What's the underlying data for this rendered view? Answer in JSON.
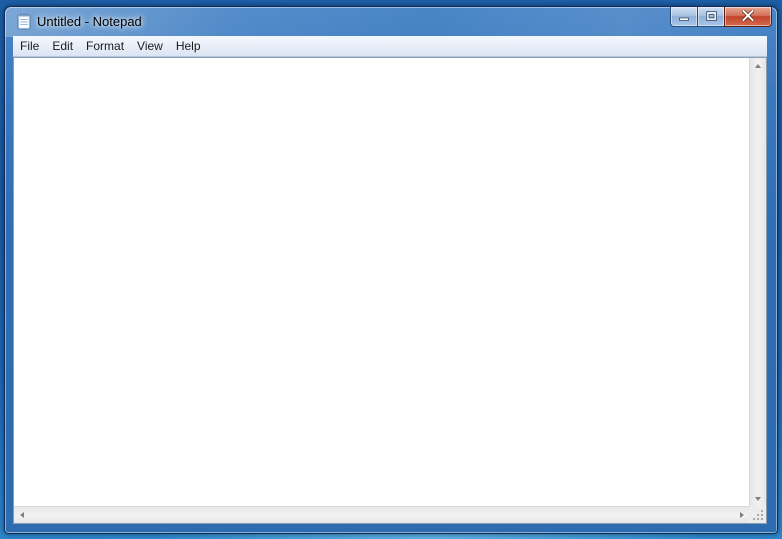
{
  "window": {
    "title": "Untitled - Notepad",
    "icon": "notepad-icon"
  },
  "caption_buttons": {
    "minimize_icon": "minimize-icon",
    "maximize_icon": "maximize-icon",
    "close_icon": "close-icon"
  },
  "menu": {
    "items": [
      {
        "label": "File"
      },
      {
        "label": "Edit"
      },
      {
        "label": "Format"
      },
      {
        "label": "View"
      },
      {
        "label": "Help"
      }
    ]
  },
  "editor": {
    "content": ""
  },
  "colors": {
    "titlebar": "#2f6db3",
    "close_button": "#c0432a",
    "menubar": "#e7eef8",
    "editor_background": "#ffffff"
  }
}
